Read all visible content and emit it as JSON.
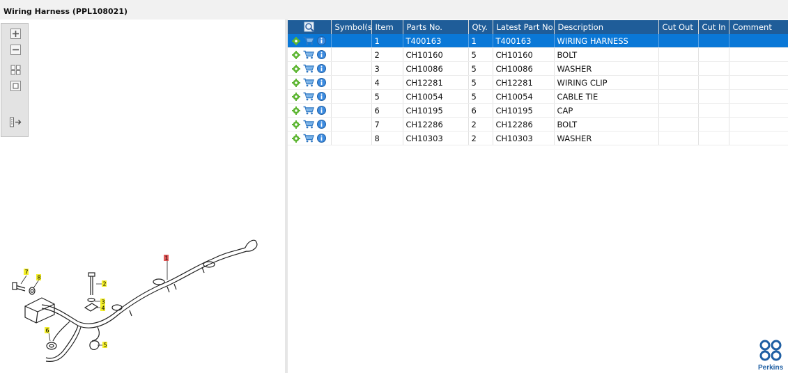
{
  "window": {
    "title": "Wiring Harness (PPL108021)"
  },
  "toolbox": {
    "buttons": [
      {
        "name": "zoom-in-icon"
      },
      {
        "name": "zoom-out-icon"
      },
      {
        "name": "fit-all-icon"
      },
      {
        "name": "actual-size-icon"
      },
      {
        "name": "panel-toggle-icon"
      }
    ]
  },
  "diagram": {
    "callouts": [
      "1",
      "2",
      "3",
      "4",
      "5",
      "6",
      "7",
      "8"
    ]
  },
  "table": {
    "columns": [
      "",
      "Symbol(s)",
      "Item",
      "Parts No.",
      "Qty.",
      "Latest Part No.",
      "Description",
      "Cut Out",
      "Cut In",
      "Comment"
    ],
    "rows": [
      {
        "item": "1",
        "parts_no": "T400163",
        "qty": "1",
        "latest": "T400163",
        "description": "WIRING HARNESS",
        "selected": true
      },
      {
        "item": "2",
        "parts_no": "CH10160",
        "qty": "5",
        "latest": "CH10160",
        "description": "BOLT",
        "selected": false
      },
      {
        "item": "3",
        "parts_no": "CH10086",
        "qty": "5",
        "latest": "CH10086",
        "description": "WASHER",
        "selected": false
      },
      {
        "item": "4",
        "parts_no": "CH12281",
        "qty": "5",
        "latest": "CH12281",
        "description": "WIRING CLIP",
        "selected": false
      },
      {
        "item": "5",
        "parts_no": "CH10054",
        "qty": "5",
        "latest": "CH10054",
        "description": "CABLE TIE",
        "selected": false
      },
      {
        "item": "6",
        "parts_no": "CH10195",
        "qty": "6",
        "latest": "CH10195",
        "description": "CAP",
        "selected": false
      },
      {
        "item": "7",
        "parts_no": "CH12286",
        "qty": "2",
        "latest": "CH12286",
        "description": "BOLT",
        "selected": false
      },
      {
        "item": "8",
        "parts_no": "CH10303",
        "qty": "2",
        "latest": "CH10303",
        "description": "WASHER",
        "selected": false
      }
    ]
  },
  "brand": {
    "name": "Perkins",
    "color": "#1f5fa3"
  },
  "colors": {
    "header": "#1f5d99",
    "selected_row": "#0a78d7",
    "callout_yellow": "#f4ef2a",
    "callout_red": "#e25858"
  }
}
